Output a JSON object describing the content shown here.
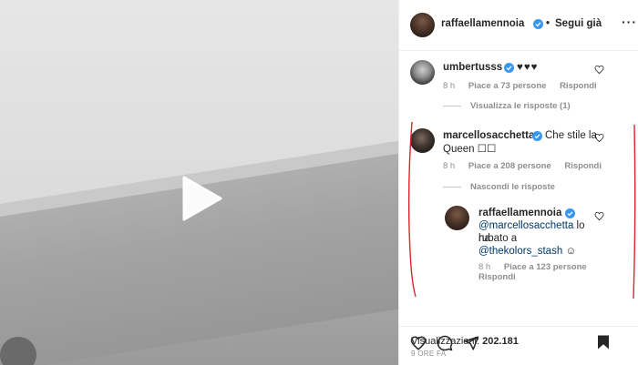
{
  "post": {
    "author": "raffaellamennoia",
    "separator": "•",
    "follow_label": "Segui già",
    "views_label": "Visualizzazioni:",
    "views_count": "202.181",
    "time_ago": "9 ORE FA"
  },
  "comments": [
    {
      "username": "umbertusss",
      "text": "♥♥♥",
      "time": "8 h",
      "likes": "Piace a 73 persone",
      "reply": "Rispondi",
      "replies_toggle": "Visualizza le risposte (1)"
    },
    {
      "username": "marcellosacchetta",
      "text": "Che stile la",
      "text2": "Queen ☐☐",
      "time": "8 h",
      "likes": "Piace a 208 persone",
      "reply": "Rispondi",
      "replies_toggle": "Nascondi le risposte"
    }
  ],
  "reply": {
    "username": "raffaellamennoia",
    "mention1": "@marcellosacchetta",
    "text1": " lo ha",
    "text2": "rubato a",
    "mention2": "@thekolors_stash",
    "emoji": "☺",
    "time": "8 h",
    "likes": "Piace a 123 persone",
    "reply": "Rispondi"
  },
  "colors": {
    "verified": "#3897f0",
    "link": "#00376b",
    "annotation": "#d9262b",
    "meta": "#8e8e8e"
  },
  "icons": [
    "play-icon",
    "verified-icon",
    "heart-icon",
    "comment-icon",
    "share-icon",
    "bookmark-icon",
    "more-icon"
  ]
}
